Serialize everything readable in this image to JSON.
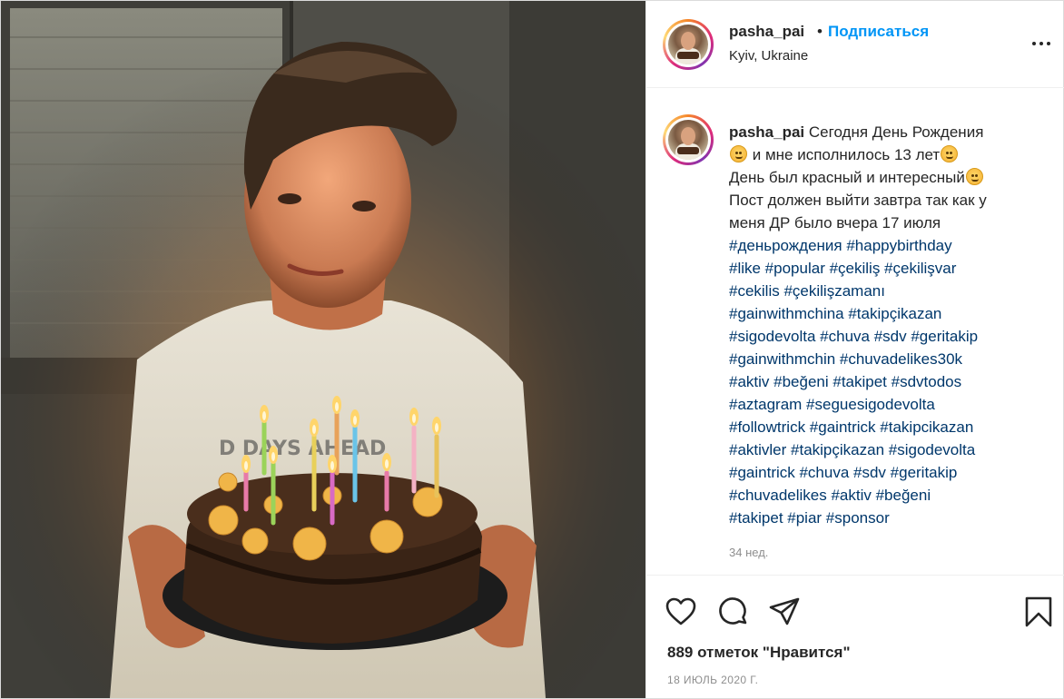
{
  "post": {
    "photo_description_icon": "birthday-photo",
    "header": {
      "username": "pasha_pai",
      "separator": "•",
      "follow_label": "Подписаться",
      "location": "Kyiv, Ukraine"
    },
    "caption": {
      "username": "pasha_pai",
      "line1": "Сегодня День Рождения",
      "line2_text": "и мне исполнилось 13 лет",
      "line3_text": "День был красный и интересный",
      "line4": "Пост должен выйти завтра так как у",
      "line5": "меня ДР было вчера 17 июля",
      "hashtag_lines": [
        "#деньрождения #happybirthday",
        "#like #popular #çekiliş #çekilişvar",
        "#cekilis #çekilişzamanı",
        "#gainwithmchina #takipçikazan",
        "#sigodevolta #chuva #sdv #geritakip",
        "#gainwithmchin #chuvadelikes30k",
        "#aktiv #beğeni #takipet #sdvtodos",
        "#aztagram #seguesigodevolta",
        "#followtrick #gaintrick #takipcikazan",
        "#aktivler #takipçikazan #sigodevolta",
        "#gaintrick #chuva #sdv #geritakip",
        "#chuvadelikes #aktiv #beğeni",
        "#takipet #piar #sponsor"
      ],
      "time_ago": "34 нед."
    },
    "actions": {
      "like_icon": "heart-icon",
      "comment_icon": "comment-icon",
      "share_icon": "paper-plane-icon",
      "save_icon": "bookmark-icon",
      "likes_text": "889 отметок \"Нравится\"",
      "date": "18 ИЮЛЬ 2020 Г."
    },
    "colors": {
      "follow_blue": "#0095f6",
      "hashtag_blue": "#00376b",
      "muted_gray": "#8e8e8e"
    }
  }
}
